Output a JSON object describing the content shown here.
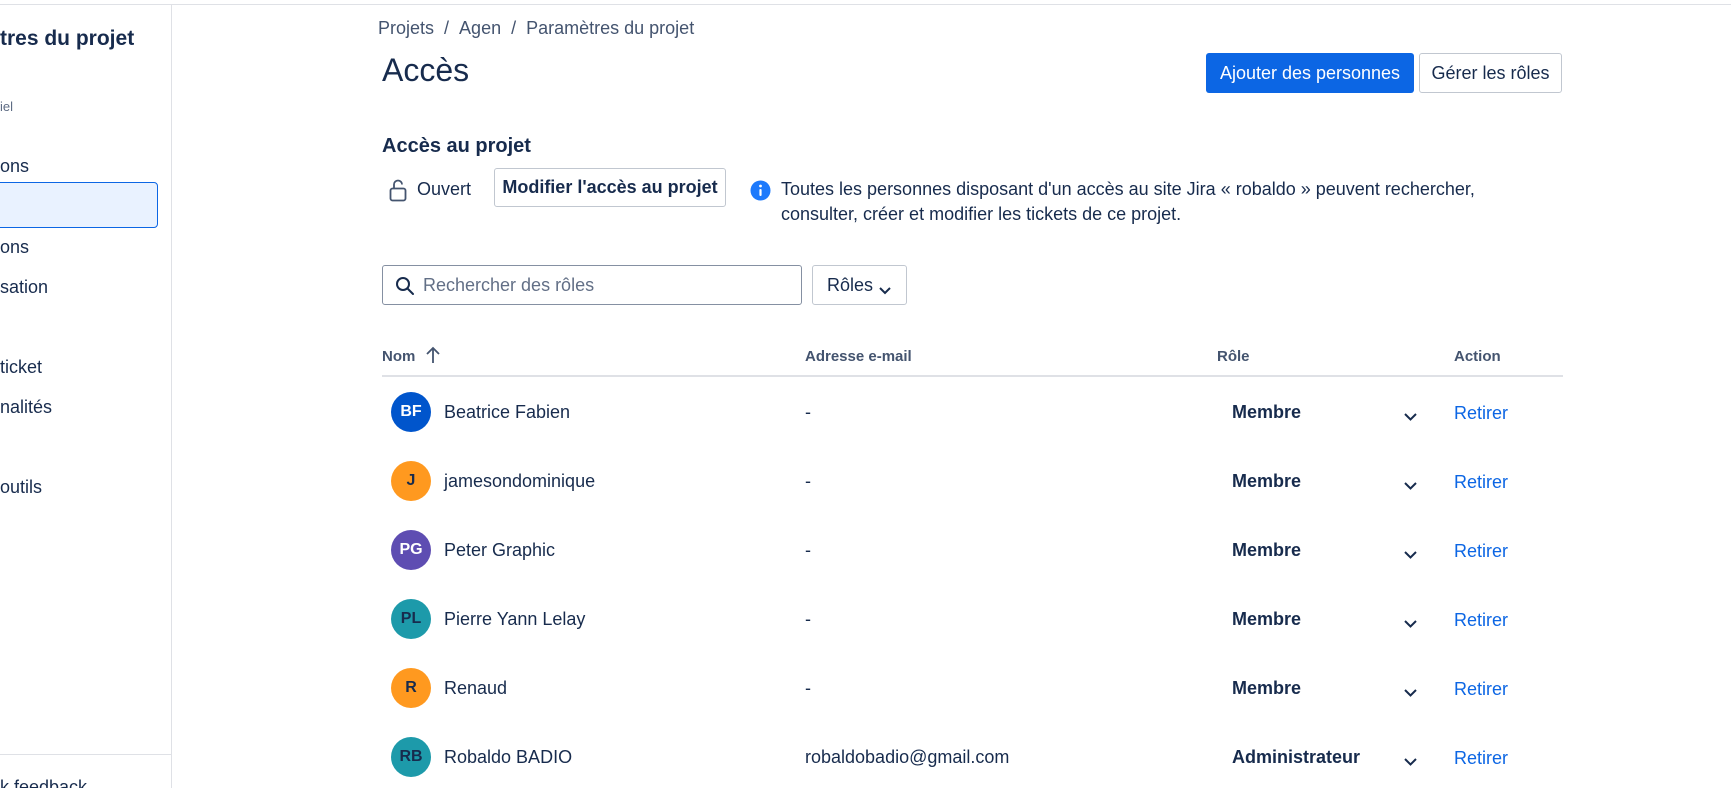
{
  "sidebar": {
    "title": "tres du projet",
    "subtitle": "iel",
    "items": [
      "ons",
      "ons",
      "sation",
      "ticket",
      "nalités",
      "outils"
    ],
    "footer": "k feedback"
  },
  "breadcrumb": [
    "Projets",
    "Agen",
    "Paramètres du projet"
  ],
  "breadcrumb_separator": "/",
  "page_title": "Accès",
  "buttons": {
    "add_people": "Ajouter des personnes",
    "manage_roles": "Gérer les rôles",
    "modify_access": "Modifier l'accès au projet"
  },
  "project_access": {
    "title": "Accès au projet",
    "status": "Ouvert",
    "info": "Toutes les personnes disposant d'un accès au site Jira « robaldo » peuvent rechercher, consulter, créer et modifier les tickets de ce projet."
  },
  "search": {
    "placeholder": "Rechercher des rôles",
    "value": ""
  },
  "roles_filter": "Rôles",
  "table": {
    "headers": {
      "name": "Nom",
      "email": "Adresse e-mail",
      "role": "Rôle",
      "action": "Action"
    },
    "rows": [
      {
        "initials": "BF",
        "name": "Beatrice Fabien",
        "email": "-",
        "role": "Membre",
        "action": "Retirer",
        "avatar_bg": "#0055cc",
        "avatar_fg": "#ffffff"
      },
      {
        "initials": "J",
        "name": "jamesondominique",
        "email": "-",
        "role": "Membre",
        "action": "Retirer",
        "avatar_bg": "#ff991f",
        "avatar_fg": "#172b4d"
      },
      {
        "initials": "PG",
        "name": "Peter Graphic",
        "email": "-",
        "role": "Membre",
        "action": "Retirer",
        "avatar_bg": "#5e4db2",
        "avatar_fg": "#ffffff"
      },
      {
        "initials": "PL",
        "name": "Pierre Yann Lelay",
        "email": "-",
        "role": "Membre",
        "action": "Retirer",
        "avatar_bg": "#1d9aaa",
        "avatar_fg": "#172b4d"
      },
      {
        "initials": "R",
        "name": "Renaud",
        "email": "-",
        "role": "Membre",
        "action": "Retirer",
        "avatar_bg": "#ff991f",
        "avatar_fg": "#172b4d"
      },
      {
        "initials": "RB",
        "name": "Robaldo BADIO",
        "email": "robaldobadio@gmail.com",
        "role": "Administrateur",
        "action": "Retirer",
        "avatar_bg": "#1d9aaa",
        "avatar_fg": "#172b4d"
      }
    ]
  },
  "colors": {
    "primary": "#0c66e4",
    "text": "#172b4d",
    "border": "#dfe1e6"
  }
}
